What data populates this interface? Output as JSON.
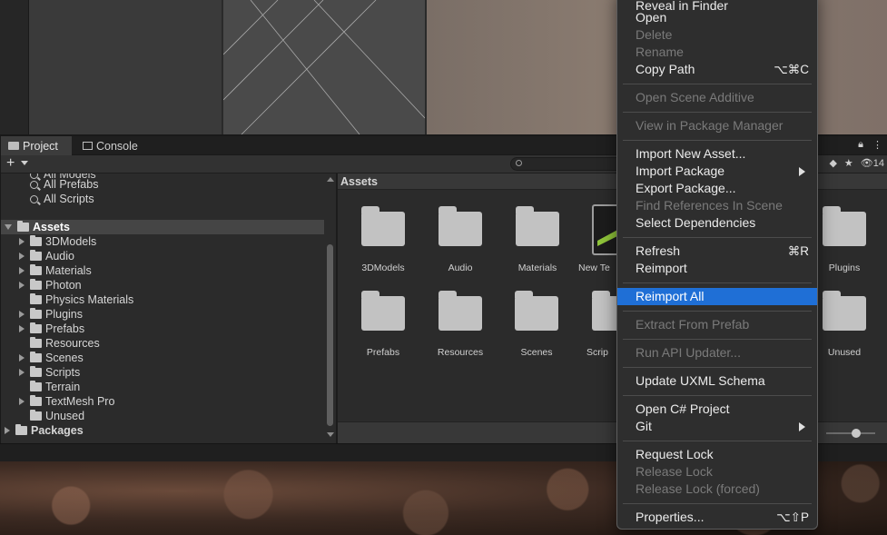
{
  "tabs": {
    "project": "Project",
    "console": "Console"
  },
  "toolbar": {
    "hidden_count": "14"
  },
  "tree": {
    "partial_top": "All Models",
    "items": [
      {
        "label": "All Prefabs",
        "type": "search"
      },
      {
        "label": "All Scripts",
        "type": "search"
      },
      {
        "label": "Assets",
        "type": "root"
      },
      {
        "label": "3DModels",
        "type": "folder",
        "expandable": true
      },
      {
        "label": "Audio",
        "type": "folder",
        "expandable": true
      },
      {
        "label": "Materials",
        "type": "folder",
        "expandable": true
      },
      {
        "label": "Photon",
        "type": "folder",
        "expandable": true
      },
      {
        "label": "Physics Materials",
        "type": "folder",
        "expandable": false
      },
      {
        "label": "Plugins",
        "type": "folder",
        "expandable": true
      },
      {
        "label": "Prefabs",
        "type": "folder",
        "expandable": true
      },
      {
        "label": "Resources",
        "type": "folder",
        "expandable": false
      },
      {
        "label": "Scenes",
        "type": "folder",
        "expandable": true
      },
      {
        "label": "Scripts",
        "type": "folder",
        "expandable": true
      },
      {
        "label": "Terrain",
        "type": "folder",
        "expandable": false
      },
      {
        "label": "TextMesh Pro",
        "type": "folder",
        "expandable": true
      },
      {
        "label": "Unused",
        "type": "folder",
        "expandable": false
      },
      {
        "label": "Packages",
        "type": "root"
      }
    ]
  },
  "assets": {
    "header": "Assets",
    "row1": [
      "3DModels",
      "Audio",
      "Materials",
      "New Te",
      "Plugins"
    ],
    "row2": [
      "Prefabs",
      "Resources",
      "Scenes",
      "Scrip",
      "Unused"
    ]
  },
  "menu": {
    "items": [
      {
        "label": "Reveal in Finder",
        "disabled": false
      },
      {
        "label": "Open",
        "disabled": false
      },
      {
        "label": "Delete",
        "disabled": true
      },
      {
        "label": "Rename",
        "disabled": true
      },
      {
        "label": "Copy Path",
        "shortcut": "⌥⌘C",
        "disabled": false
      },
      {
        "label": "Open Scene Additive",
        "disabled": true
      },
      {
        "label": "View in Package Manager",
        "disabled": true
      },
      {
        "label": "Import New Asset...",
        "disabled": false
      },
      {
        "label": "Import Package",
        "submenu": true,
        "disabled": false
      },
      {
        "label": "Export Package...",
        "disabled": false
      },
      {
        "label": "Find References In Scene",
        "disabled": true
      },
      {
        "label": "Select Dependencies",
        "disabled": false
      },
      {
        "label": "Refresh",
        "shortcut": "⌘R",
        "disabled": false
      },
      {
        "label": "Reimport",
        "disabled": false
      },
      {
        "label": "Reimport All",
        "highlighted": true,
        "disabled": false
      },
      {
        "label": "Extract From Prefab",
        "disabled": true
      },
      {
        "label": "Run API Updater...",
        "disabled": true
      },
      {
        "label": "Update UXML Schema",
        "disabled": false
      },
      {
        "label": "Open C# Project",
        "disabled": false
      },
      {
        "label": "Git",
        "submenu": true,
        "disabled": false
      },
      {
        "label": "Request Lock",
        "disabled": false
      },
      {
        "label": "Release Lock",
        "disabled": true
      },
      {
        "label": "Release Lock (forced)",
        "disabled": true
      },
      {
        "label": "Properties...",
        "shortcut": "⌥⇧P",
        "disabled": false
      }
    ]
  },
  "colors": {
    "highlight": "#1f6fd6",
    "panel": "#2b2b2b",
    "menu_bg": "#2e2e2e"
  }
}
